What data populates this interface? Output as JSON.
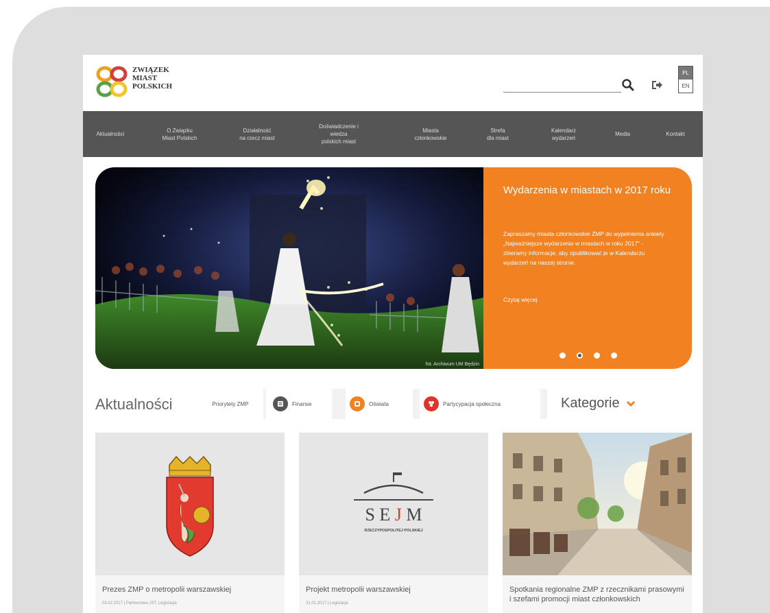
{
  "header": {
    "logo_lines": [
      "ZWIĄZEK",
      "MIAST",
      "POLSKICH"
    ],
    "lang_options": [
      "PL",
      "EN"
    ],
    "lang_active": "PL"
  },
  "nav": {
    "items": [
      {
        "label": "Aktualności"
      },
      {
        "label": "O Związku\nMiast Polskich"
      },
      {
        "label": "Działalność\nna rzecz miast"
      },
      {
        "label": "Doświadczenie i\nwiedza\npolskich miast"
      },
      {
        "label": "Miasta\nczłonkowskie"
      },
      {
        "label": "Strefa\ndla miast"
      },
      {
        "label": "Kalendarz\nwydarzeń"
      },
      {
        "label": "Media"
      },
      {
        "label": "Kontakt"
      }
    ]
  },
  "hero": {
    "title": "Wydarzenia w miastach w 2017 roku",
    "text": "Zapraszamy miasta członkowskie ZMP do wypełnienia ankiety „Najważniejsze wydarzenia w miastach w roku 2017\" - zbieramy informacje, aby opublikować je w Kalendarzu wydarzeń na naszej stronie.",
    "more": "Czytaj więcej",
    "photo_credit": "fot. Archiwum UM Będzin",
    "slide_count": 4,
    "active_slide": 2
  },
  "news": {
    "title": "Aktualności",
    "categories": [
      {
        "label": "Priorytety ZMP",
        "icon": "none"
      },
      {
        "label": "Finanse",
        "icon": "finance-icon",
        "color": "#555555"
      },
      {
        "label": "Oświata",
        "icon": "education-icon",
        "color": "#f28121"
      },
      {
        "label": "Partycypacja społeczna",
        "icon": "participation-icon",
        "color": "#e0342b"
      }
    ],
    "kategorie_label": "Kategorie"
  },
  "cards": [
    {
      "title": "Prezes ZMP o metropolii warszawskiej",
      "meta": "03.02.2017 | Partnerstwa JST, Legislacja",
      "image": "warsaw-coat-of-arms"
    },
    {
      "title": "Projekt metropolii warszawskiej",
      "meta": "31.01.2017 | Legislacja",
      "image": "sejm-logo",
      "logo_text": "S E J M",
      "logo_sub": "RZECZYPOSPOLITEJ POLSKIEJ"
    },
    {
      "title": "Spotkania regionalne ZMP z rzecznikami prasowymi i szefami promocji miast członkowskich",
      "meta": "",
      "image": "city-street-photo"
    }
  ]
}
